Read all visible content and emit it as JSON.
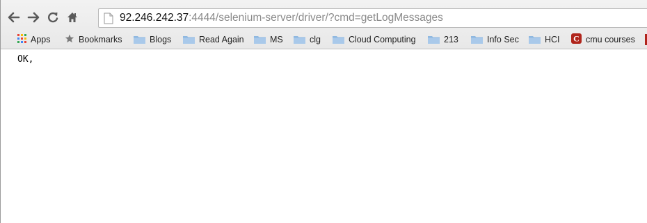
{
  "browser": {
    "address_bar": {
      "host": "92.246.242.37",
      "rest": ":4444/selenium-server/driver/?cmd=getLogMessages"
    },
    "nav_icons": [
      "back-arrow-icon",
      "forward-arrow-icon",
      "reload-icon",
      "home-icon"
    ]
  },
  "bookmarks_bar": {
    "apps_label": "Apps",
    "bookmarks_label": "Bookmarks",
    "folders": [
      "Blogs",
      "Read Again",
      "MS",
      "clg",
      "Cloud Computing",
      "213",
      "Info Sec",
      "HCI"
    ],
    "cmu_label": "cmu courses",
    "cmu_badge_letter": "C"
  },
  "page": {
    "body_text": "OK,"
  },
  "colors": {
    "folder": "#8fb8e0",
    "cmu_badge": "#b0251c",
    "host_text": "#111111",
    "path_text": "#8a8a8a"
  }
}
